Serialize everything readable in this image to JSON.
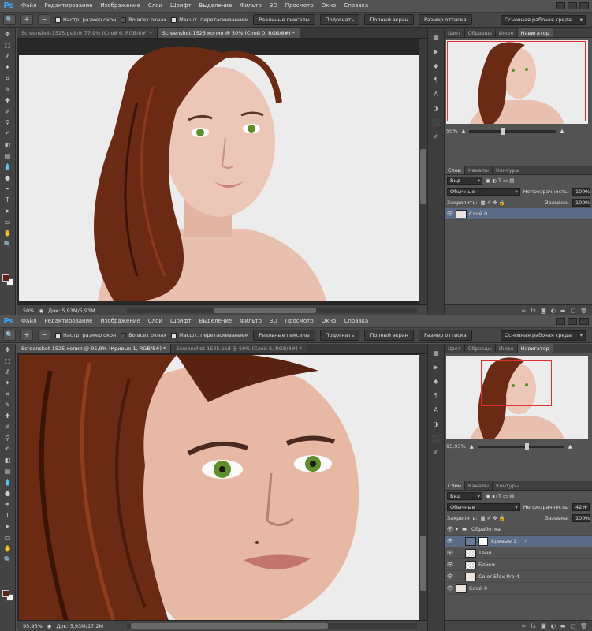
{
  "menu": [
    "Файл",
    "Редактирование",
    "Изображение",
    "Слои",
    "Шрифт",
    "Выделение",
    "Фильтр",
    "3D",
    "Просмотр",
    "Окно",
    "Справка"
  ],
  "logo": "Ps",
  "options": {
    "resize_windows": "Настр. размер окон",
    "all_windows": "Во всех окнах",
    "scrubby_zoom": "Масшт. перетаскиванием",
    "actual_pixels": "Реальные пикселы",
    "fit_screen": "Подогнать",
    "full_screen": "Полный экран",
    "print_size": "Размер оттиска",
    "workspace": "Основная рабочая среда"
  },
  "win1": {
    "tabs": [
      "Screenshot-1525.psd @ 77,9% (Слой 6, RGB/8#) *",
      "Screenshot-1525 копия @ 50% (Слой 0, RGB/8#) *"
    ],
    "active_tab": 1,
    "zoom": "50%",
    "doc_size": "Док: 5,93M/5,93M",
    "nav_zoom": "50%",
    "panel_tabs": [
      "Цвет",
      "Образцы",
      "Инфо",
      "Навигатор"
    ],
    "layer_tabs": [
      "Слои",
      "Каналы",
      "Контуры"
    ],
    "filter": "Вид",
    "blend": "Обычные",
    "opacity_label": "Непрозрачность:",
    "opacity": "100%",
    "lock_label": "Закрепить:",
    "fill_label": "Заливка:",
    "fill": "100%",
    "layers": [
      {
        "name": "Слой 0"
      }
    ]
  },
  "win2": {
    "tabs": [
      "Screenshot-1525 копия @ 95,9% (Кривые 1, RGB/8#) *",
      "Screenshot-1525.psd @ 59% (Слой 6, RGB/8#) *"
    ],
    "active_tab": 0,
    "zoom": "95,93%",
    "doc_size": "Док: 5,93M/17,2M",
    "nav_zoom": "95,93%",
    "panel_tabs": [
      "Цвет",
      "Образцы",
      "Инфо",
      "Навигатор"
    ],
    "layer_tabs": [
      "Слои",
      "Каналы",
      "Контуры"
    ],
    "filter": "Вид",
    "blend": "Обычные",
    "opacity_label": "Непрозрачность:",
    "opacity": "42%",
    "lock_label": "Закрепить:",
    "fill_label": "Заливка:",
    "fill": "100%",
    "layers": [
      {
        "name": "Обработка"
      },
      {
        "name": "Кривые 1"
      },
      {
        "name": "Тени"
      },
      {
        "name": "Блики"
      },
      {
        "name": "Color Efex Pro 4"
      },
      {
        "name": "Слой 0"
      }
    ]
  },
  "colors": {
    "accent": "#3aa7ff",
    "selected_layer": "#5c6b87",
    "nav_frame": "#e03030",
    "foreground": "#5e2418",
    "background": "#f2f2f2"
  }
}
